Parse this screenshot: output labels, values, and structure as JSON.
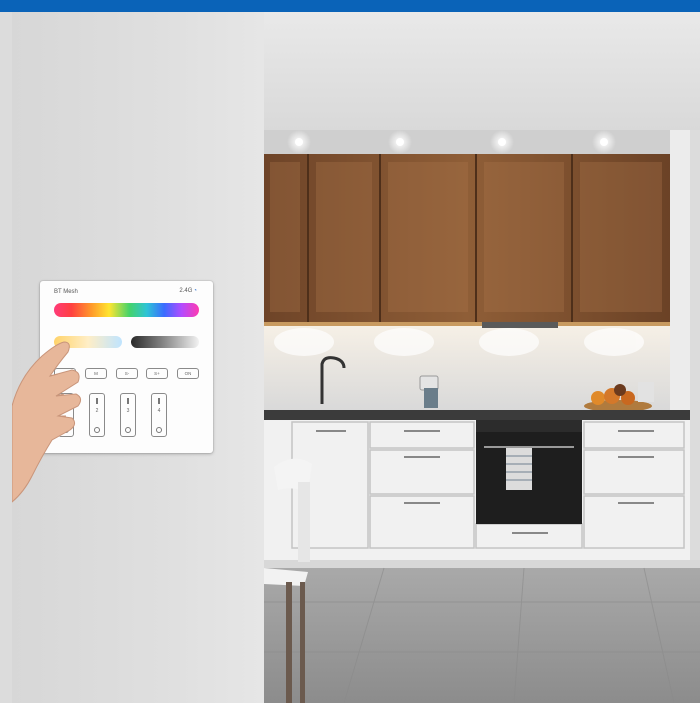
{
  "panel": {
    "title": "BT Mesh",
    "frequency": "2.4G",
    "wifi_icon": "wifi-icon",
    "mode_buttons": [
      "",
      "M",
      "S-",
      "S+",
      "ON"
    ],
    "zones": [
      "1",
      "2",
      "3",
      "4"
    ]
  },
  "colors": {
    "header_bar": "#0a63b8",
    "wall": "#dcdcdc",
    "cabinet_wood": "#8a5a34",
    "cabinet_white": "#f2f2f2",
    "floor": "#9a9a9a"
  }
}
